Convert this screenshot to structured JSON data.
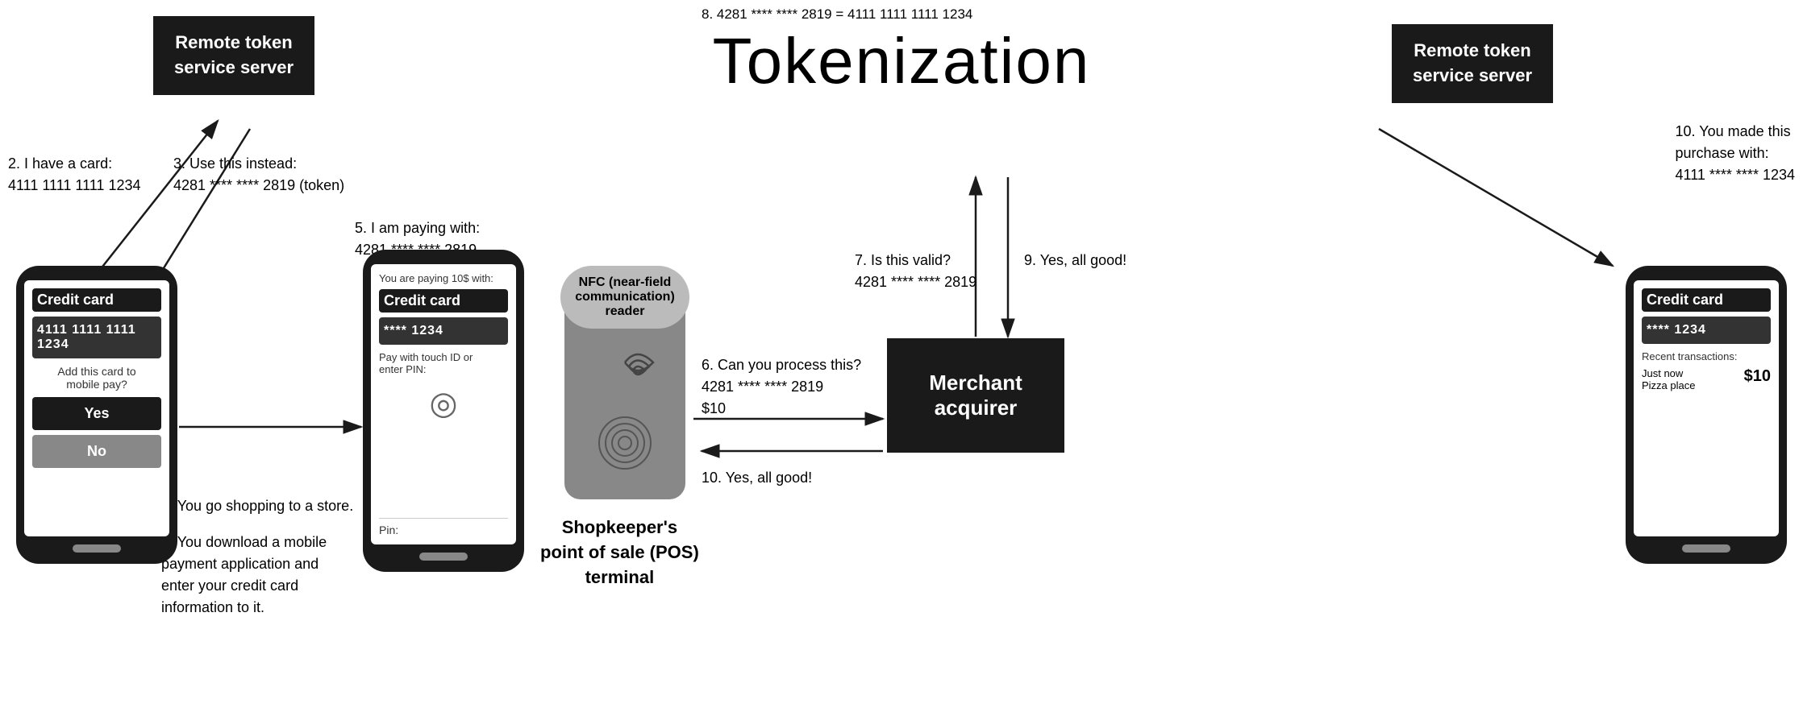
{
  "title": "Tokenization",
  "step8": "8. 4281 **** **** 2819 = 4111 1111 1111 1234",
  "remoteTokenLeft": "Remote token\nservice server",
  "remoteTokenRight": "Remote token\nservice server",
  "merchantAcquirer": "Merchant acquirer",
  "annotations": {
    "step1": "1. You download a mobile\npayment application and\nenter your credit card\ninformation to it.",
    "step2": "2. I have a card:\n4111 1111 1111 1234",
    "step3": "3. Use this instead:\n4281 **** **** 2819 (token)",
    "step4": "4. You go shopping to a store.",
    "step5": "5. I am paying with:\n4281 **** **** 2819",
    "step6": "6. Can you process this?\n4281 **** **** 2819\n$10",
    "step7": "7. Is this valid?\n4281 **** **** 2819",
    "step9": "9. Yes, all good!",
    "step10left": "10. Yes, all good!",
    "step10right": "10. You made this\npurchase with:\n4111 **** **** 1234"
  },
  "leftPhone": {
    "cardLabel": "Credit card",
    "cardNumber": "4111 1111 1111 1234",
    "addText": "Add this card to\nmobile pay?",
    "yesBtn": "Yes",
    "noBtn": "No"
  },
  "middlePhone": {
    "payingText": "You are paying 10$ with:",
    "cardLabel": "Credit card",
    "cardNumber": "**** 1234",
    "touchText": "Pay with touch ID or\nenter PIN:",
    "pinLabel": "Pin:"
  },
  "rightPhone": {
    "cardLabel": "Credit card",
    "cardNumber": "**** 1234",
    "recentLabel": "Recent transactions:",
    "transactionTime": "Just now",
    "transactionPlace": "Pizza place",
    "transactionAmount": "$10"
  },
  "nfc": {
    "bubbleText": "NFC (near-field\ncommunication)\nreader",
    "shopkeeperLabel": "Shopkeeper's\npoint of sale (POS)\nterminal"
  }
}
